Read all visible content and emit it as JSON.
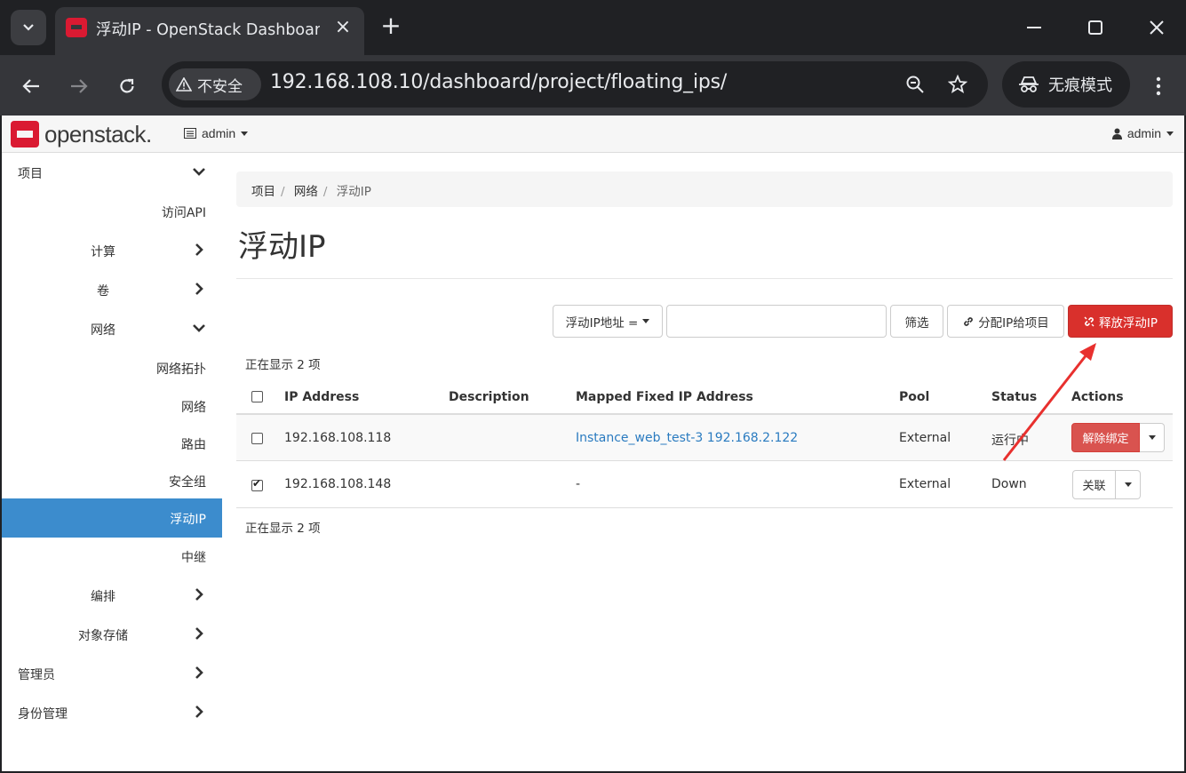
{
  "browser": {
    "tab_title": "浮动IP - OpenStack Dashboard",
    "url": "192.168.108.10/dashboard/project/floating_ips/",
    "security_label": "不安全",
    "incognito_label": "无痕模式"
  },
  "header": {
    "logo_text": "openstack.",
    "project_selector": "admin",
    "user_menu": "admin"
  },
  "sidebar": {
    "items": [
      {
        "label": "项目"
      },
      {
        "label": "访问API"
      },
      {
        "label": "计算"
      },
      {
        "label": "卷"
      },
      {
        "label": "网络"
      },
      {
        "label": "网络拓扑"
      },
      {
        "label": "网络"
      },
      {
        "label": "路由"
      },
      {
        "label": "安全组"
      },
      {
        "label": "浮动IP"
      },
      {
        "label": "中继"
      },
      {
        "label": "编排"
      },
      {
        "label": "对象存储"
      },
      {
        "label": "管理员"
      },
      {
        "label": "身份管理"
      }
    ]
  },
  "breadcrumb": [
    "项目",
    "网络",
    "浮动IP"
  ],
  "page_title": "浮动IP",
  "toolbar": {
    "filter_field": "浮动IP地址 =",
    "filter_value": "",
    "filter_button": "筛选",
    "allocate_button": "分配IP给项目",
    "release_button": "释放浮动IP"
  },
  "table": {
    "count_label": "正在显示 2 项",
    "headers": [
      "IP Address",
      "Description",
      "Mapped Fixed IP Address",
      "Pool",
      "Status",
      "Actions"
    ],
    "rows": [
      {
        "ip": "192.168.108.118",
        "description": "",
        "mapped": "Instance_web_test-3 192.168.2.122",
        "pool": "External",
        "status": "运行中",
        "action": "解除绑定",
        "checked": false
      },
      {
        "ip": "192.168.108.148",
        "description": "",
        "mapped": "-",
        "pool": "External",
        "status": "Down",
        "action": "关联",
        "checked": true
      }
    ]
  },
  "colors": {
    "sidebar_active": "#3c8ccd",
    "danger": "#d9302c",
    "link": "#2a7bc0",
    "annotation_arrow": "#e8302e"
  }
}
